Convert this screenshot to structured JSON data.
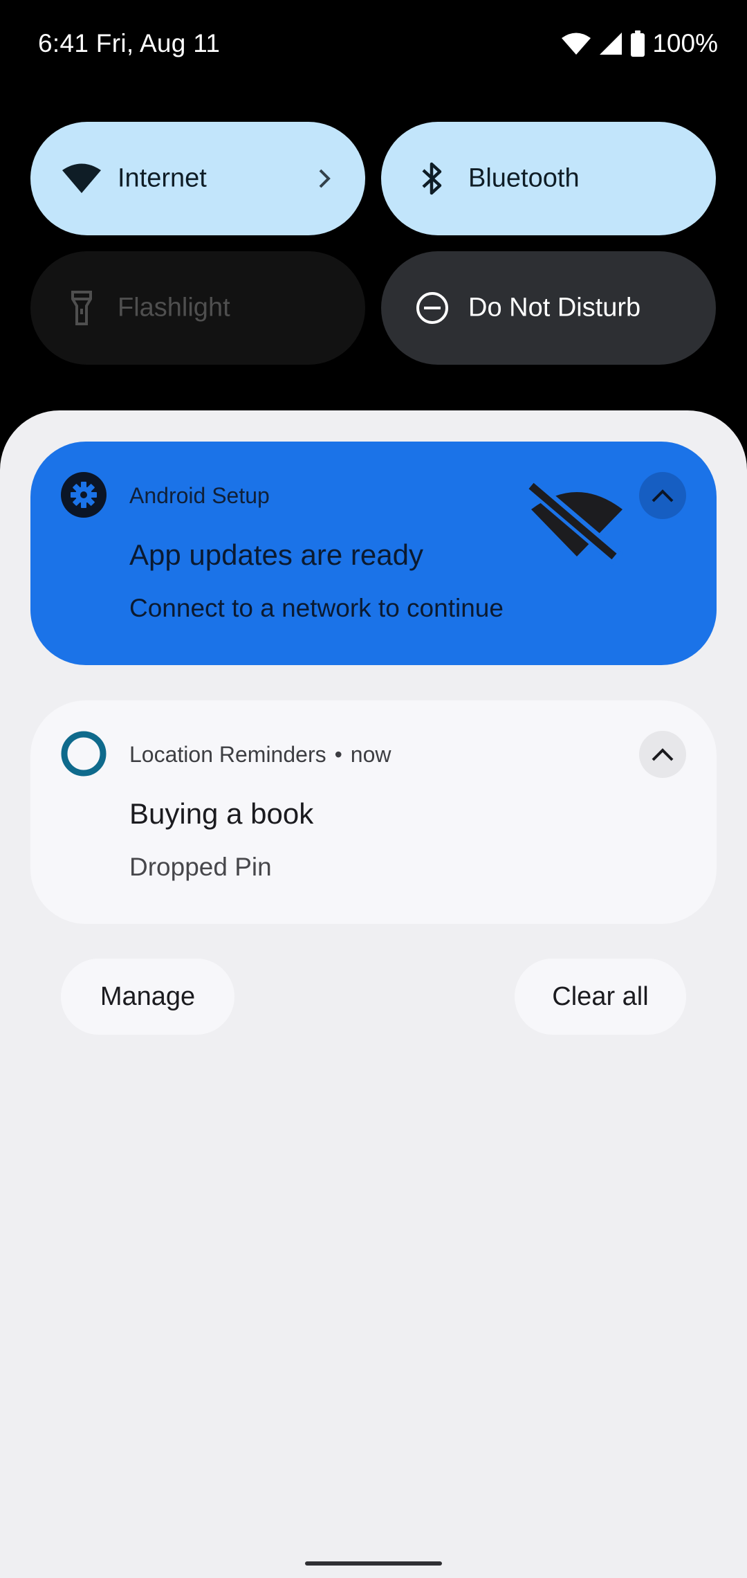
{
  "status_bar": {
    "time_date": "6:41 Fri, Aug 11",
    "battery": "100%",
    "icons": [
      "wifi-icon",
      "cell-signal-icon",
      "battery-icon"
    ]
  },
  "quick_settings": {
    "tiles": [
      {
        "label": "Internet",
        "icon": "wifi-icon",
        "state": "on"
      },
      {
        "label": "Bluetooth",
        "icon": "bluetooth-icon",
        "state": "on"
      },
      {
        "label": "Flashlight",
        "icon": "flashlight-icon",
        "state": "unavailable"
      },
      {
        "label": "Do Not Disturb",
        "icon": "dnd-icon",
        "state": "off"
      }
    ]
  },
  "notifications": [
    {
      "app_name": "Android Setup",
      "title": "App updates are ready",
      "text": "Connect to a network to continue",
      "icon": "gear-icon",
      "large_icon": "wifi-off-icon",
      "accent": "#1b73e8"
    },
    {
      "app_name": "Location Reminders",
      "separator": "•",
      "time": "now",
      "title": "Buying a book",
      "text": "Dropped Pin",
      "icon": "ring-icon",
      "accent": "#0f6a8c"
    }
  ],
  "actions": {
    "manage": "Manage",
    "clear_all": "Clear all"
  }
}
